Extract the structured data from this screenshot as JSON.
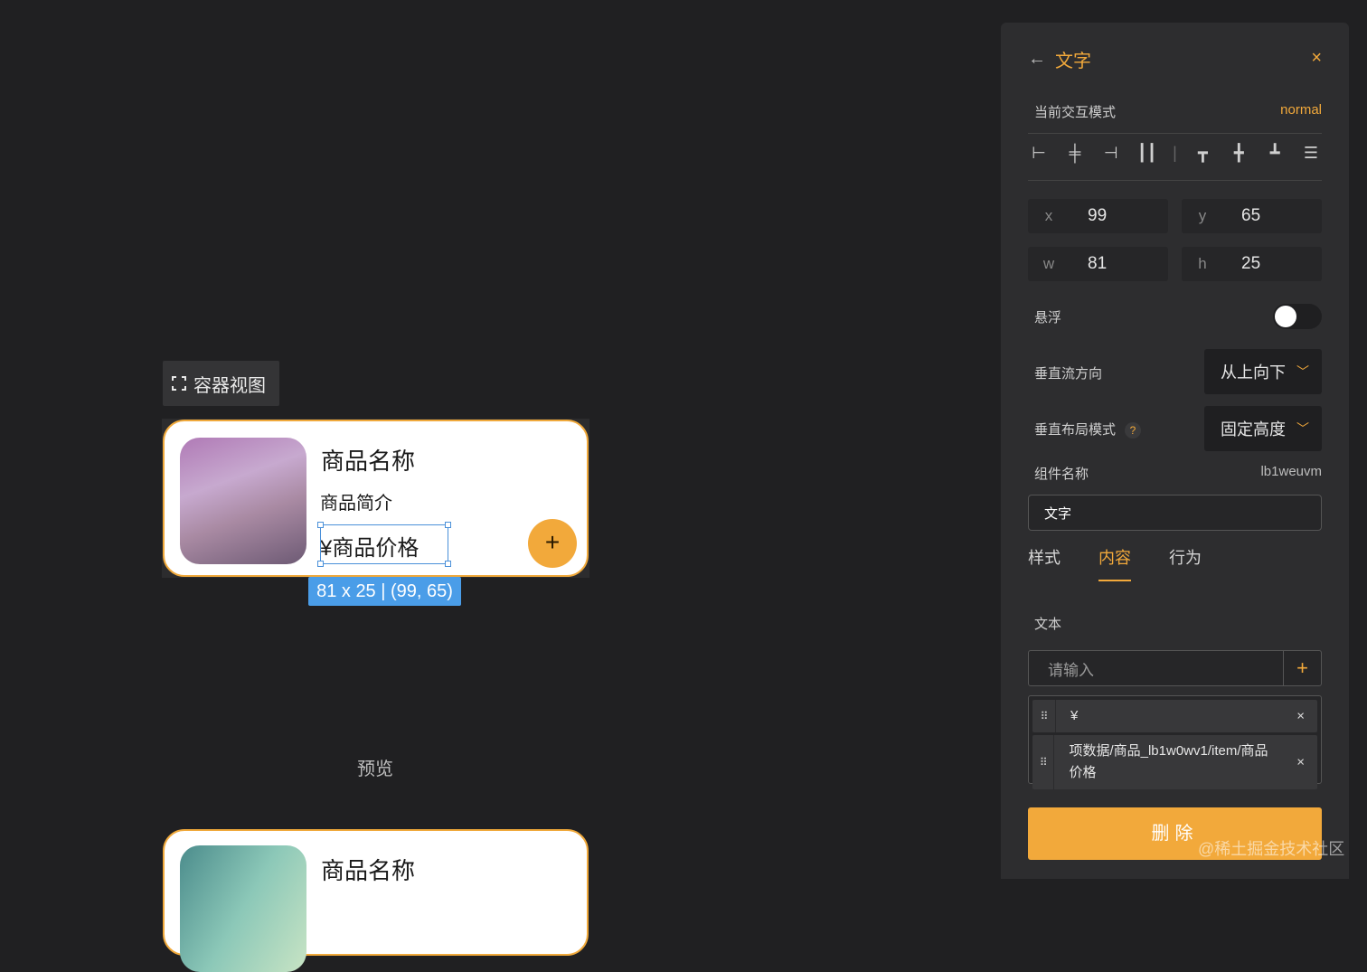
{
  "canvas": {
    "container_view_label": "容器视图",
    "card": {
      "title": "商品名称",
      "description": "商品简介",
      "price": "¥商品价格",
      "add_symbol": "+"
    },
    "selection_tag": "81 x 25 | (99, 65)",
    "preview_label": "预览",
    "preview_card": {
      "title": "商品名称"
    }
  },
  "panel": {
    "back_symbol": "←",
    "title": "文字",
    "close_symbol": "×",
    "interaction_mode_label": "当前交互模式",
    "interaction_mode_value": "normal",
    "align_icons": [
      "align-left",
      "align-center-h",
      "align-right",
      "distribute-h",
      "align-top",
      "align-center-v",
      "align-bottom",
      "distribute-v"
    ],
    "x_label": "x",
    "x_value": "99",
    "y_label": "y",
    "y_value": "65",
    "w_label": "w",
    "w_value": "81",
    "h_label": "h",
    "h_value": "25",
    "float_label": "悬浮",
    "float_on": false,
    "vertical_flow_label": "垂直流方向",
    "vertical_flow_value": "从上向下",
    "vertical_layout_label": "垂直布局模式",
    "help_symbol": "?",
    "vertical_layout_value": "固定高度",
    "component_name_label": "组件名称",
    "component_id": "lb1weuvm",
    "component_name_value": "文字",
    "tabs": [
      "样式",
      "内容",
      "行为"
    ],
    "active_tab": "内容",
    "text_label": "文本",
    "text_placeholder": "请输入",
    "text_add_symbol": "+",
    "text_tags": [
      {
        "text": "¥"
      },
      {
        "text": "项数据/商品_lb1w0wv1/item/商品价格"
      }
    ],
    "tag_remove_symbol": "×",
    "delete_label": "删除"
  },
  "watermark": "@稀土掘金技术社区",
  "colors": {
    "accent": "#f2a93b",
    "selection": "#4a9de8",
    "background": "#202022",
    "panel": "#2d2d2f"
  }
}
